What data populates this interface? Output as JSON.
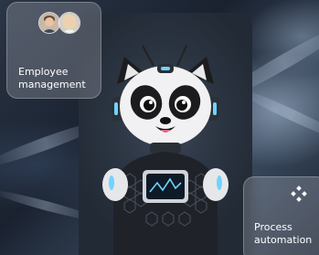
{
  "employee_card": {
    "label": "Employee\nmanagement",
    "avatars": [
      "avatar-man",
      "avatar-woman"
    ]
  },
  "process_card": {
    "label": "Process\nautomation",
    "icon": "puzzle-nodes-icon"
  },
  "colors": {
    "background": "#1a2230",
    "card_fill": "rgba(230,234,240,0.22)",
    "robot_accent": "#6fd3ff"
  }
}
